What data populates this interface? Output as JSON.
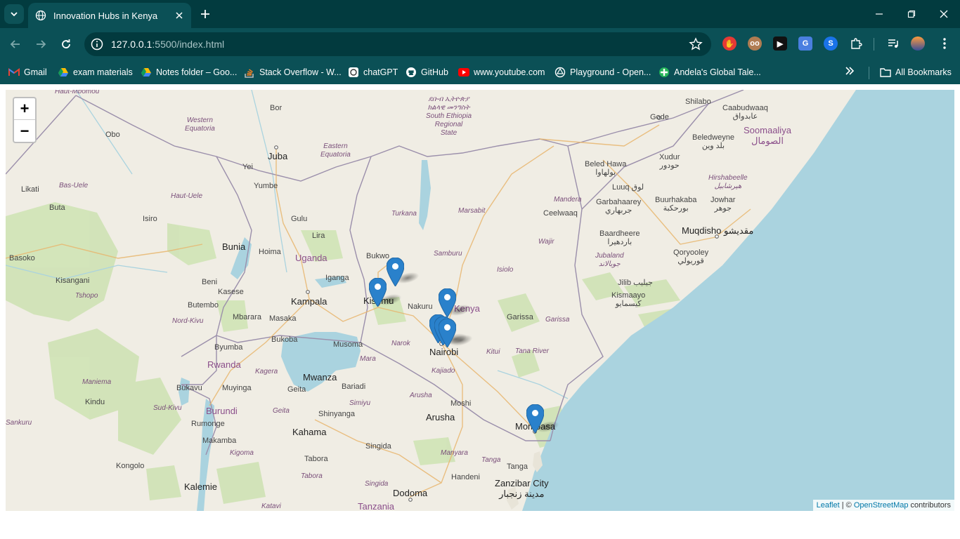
{
  "browser": {
    "tab_title": "Innovation Hubs in Kenya",
    "url_host": "127.0.0.1",
    "url_rest": ":5500/index.html",
    "bookmarks": [
      {
        "label": "Gmail",
        "icon": "gmail-icon"
      },
      {
        "label": "exam materials",
        "icon": "drive-icon"
      },
      {
        "label": "Notes folder – Goo...",
        "icon": "drive-icon"
      },
      {
        "label": "Stack Overflow - W...",
        "icon": "stackoverflow-icon"
      },
      {
        "label": "chatGPT",
        "icon": "chatgpt-icon"
      },
      {
        "label": "GitHub",
        "icon": "github-icon"
      },
      {
        "label": "www.youtube.com",
        "icon": "youtube-icon"
      },
      {
        "label": "Playground - Open...",
        "icon": "openai-icon"
      },
      {
        "label": "Andela's Global Tale...",
        "icon": "andela-icon"
      }
    ],
    "all_bookmarks": "All Bookmarks"
  },
  "map": {
    "zoom_in": "+",
    "zoom_out": "−",
    "attribution": {
      "leaflet": "Leaflet",
      "sep": " | © ",
      "osm": "OpenStreetMap",
      "suffix": " contributors"
    },
    "labels": {
      "haut_mbomou": "Haut-Mbomou",
      "bor": "Bor",
      "south_ethiopia": "ደቡብ ኢትዮጵያ\nክልላዊ መንግስት\nSouth Ethiopia\nRegional\nState",
      "shilabo": "Shilabo",
      "caabudwaaq": "Caabudwaaq\nعابدواق",
      "western_equatoria": "Western\nEquatoria",
      "obo": "Obo",
      "gode": "Gode",
      "soomaaliya": "Soomaaliya\nالصومال",
      "beledweyne": "Beledweyne\nبلد وين",
      "eastern_equatoria": "Eastern\nEquatoria",
      "juba": "Juba",
      "xudur": "Xudur\nحودور",
      "beled_hawa": "Beled Hawa\nبولهاوا",
      "yei": "Yei",
      "bas_uele": "Bas-Uele",
      "yumbe": "Yumbe",
      "luuq": "Luuq لوق",
      "hirshabeelle": "Hirshabeelle\nهيرشابيل",
      "likati": "Likati",
      "haut_uele": "Haut-Uele",
      "turkana": "Turkana",
      "mandera": "Mandera",
      "garbahaarey": "Garbahaarey\nجربهاري",
      "buurhakaba": "Buurhakaba\nبورحكبة",
      "jowhar": "Jowhar\nجوهر",
      "buta": "Buta",
      "marsabit": "Marsabit",
      "ceelwaaq": "Ceelwaaq",
      "isiro": "Isiro",
      "gulu": "Gulu",
      "baardheere": "Baardheere\nباردهيرا",
      "muqdisho": "Muqdisho مقديشو",
      "lira": "Lira",
      "wajir": "Wajir",
      "bunia": "Bunia",
      "hoima": "Hoima",
      "samburu": "Samburu",
      "qoryooley": "Qoryooley\nقوريولي",
      "basoko": "Basoko",
      "uganda": "Uganda",
      "bukwo": "Bukwo",
      "jubaland": "Jubaland\nجوبالاند",
      "isiolo": "Isiolo",
      "kisangani": "Kisangani",
      "beni": "Beni",
      "iganga": "Iganga",
      "jilib": "Jilib جيليب",
      "tshopo": "Tshopo",
      "kasese": "Kasese",
      "kampala": "Kampala",
      "kisumu": "Kisumu",
      "kismaayo": "Kismaayo\nكيسمايو",
      "butembo": "Butembo",
      "nakuru": "Nakuru",
      "kenya": "Kenya",
      "mbarara": "Mbarara",
      "masaka": "Masaka",
      "garissa": "Garissa",
      "garissa_region": "Garissa",
      "nord_kivu": "Nord-Kivu",
      "narok": "Narok",
      "bukoba": "Bukoba",
      "musoma": "Musoma",
      "nairobi": "Nairobi",
      "byumba": "Byumba",
      "kitui": "Kitui",
      "tana_river": "Tana River",
      "rwanda": "Rwanda",
      "mara": "Mara",
      "kajiado": "Kajiado",
      "kagera": "Kagera",
      "mwanza": "Mwanza",
      "maniema": "Maniema",
      "bukavu": "Bukavu",
      "muyinga": "Muyinga",
      "geita": "Geita",
      "bariadi": "Bariadi",
      "arusha_region": "Arusha",
      "kindu": "Kindu",
      "simiyu": "Simiyu",
      "moshi": "Moshi",
      "sud_kivu": "Sud-Kivu",
      "burundi": "Burundi",
      "geita_region": "Geita",
      "shinyanga": "Shinyanga",
      "arusha": "Arusha",
      "mombasa": "Mombasa",
      "sankuru": "Sankuru",
      "rumonge": "Rumonge",
      "kahama": "Kahama",
      "makamba": "Makamba",
      "singida": "Singida",
      "manyara": "Manyara",
      "kigoma": "Kigoma",
      "kongolo": "Kongolo",
      "tabora": "Tabora",
      "tanga_region": "Tanga",
      "handeni": "Handeni",
      "tanga": "Tanga",
      "tabora_region": "Tabora",
      "zanzibar": "Zanzibar City\nمدينة زنجبار",
      "kalemie": "Kalemie",
      "singida_region": "Singida",
      "dodoma": "Dodoma",
      "katavi": "Katavi",
      "tanzania": "Tanzania"
    }
  },
  "colors": {
    "chrome_dark": "#023b3f",
    "chrome": "#0b5056",
    "water": "#aad3df",
    "land": "#f0ede4",
    "park": "#cde5b4",
    "marker": "#2a81cb"
  }
}
